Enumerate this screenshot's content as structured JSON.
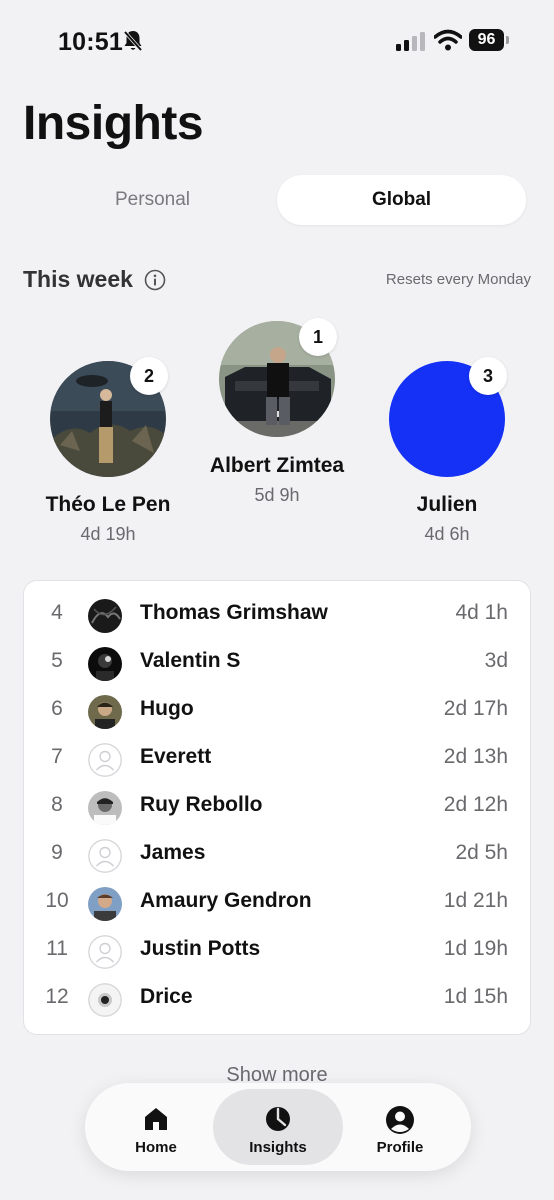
{
  "status_bar": {
    "time": "10:51",
    "battery": "96"
  },
  "page_title": "Insights",
  "segments": {
    "personal": "Personal",
    "global": "Global"
  },
  "section": {
    "title": "This week",
    "resets": "Resets every Monday"
  },
  "podium": [
    {
      "rank": "2",
      "name": "Théo Le Pen",
      "time": "4d 19h"
    },
    {
      "rank": "1",
      "name": "Albert Zimtea",
      "time": "5d 9h"
    },
    {
      "rank": "3",
      "name": "Julien",
      "time": "4d 6h",
      "avatar_color": "#1431f5"
    }
  ],
  "leaderboard": [
    {
      "rank": "4",
      "name": "Thomas Grimshaw",
      "time": "4d 1h"
    },
    {
      "rank": "5",
      "name": "Valentin S",
      "time": "3d"
    },
    {
      "rank": "6",
      "name": "Hugo",
      "time": "2d 17h"
    },
    {
      "rank": "7",
      "name": "Everett",
      "time": "2d 13h"
    },
    {
      "rank": "8",
      "name": "Ruy Rebollo",
      "time": "2d 12h"
    },
    {
      "rank": "9",
      "name": "James",
      "time": "2d 5h"
    },
    {
      "rank": "10",
      "name": "Amaury Gendron",
      "time": "1d 21h"
    },
    {
      "rank": "11",
      "name": "Justin Potts",
      "time": "1d 19h"
    },
    {
      "rank": "12",
      "name": "Drice",
      "time": "1d 15h"
    }
  ],
  "show_more": "Show more",
  "tabs": {
    "home": "Home",
    "insights": "Insights",
    "profile": "Profile"
  }
}
